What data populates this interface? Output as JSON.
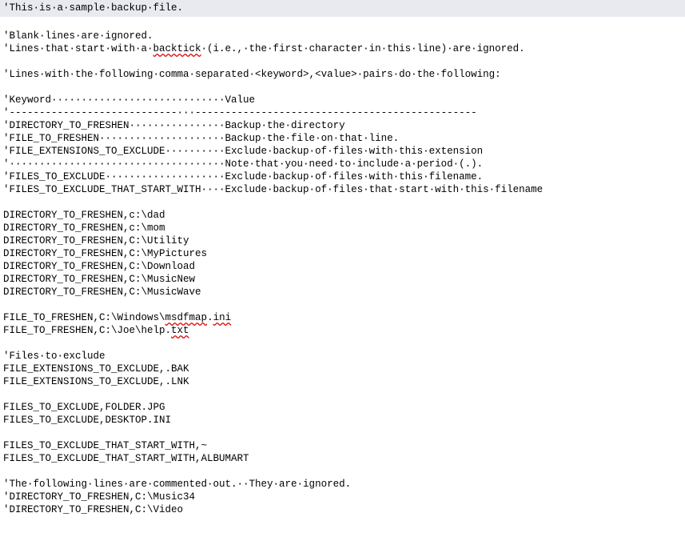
{
  "header": {
    "bg": "#e9e9f0",
    "text": "'This·is·a·sample·backup·file."
  },
  "lines": [
    {
      "t": "blank"
    },
    {
      "t": "line",
      "txt": "'Blank·lines·are·ignored."
    },
    {
      "t": "line",
      "parts": [
        {
          "s": "plain",
          "txt": "'Lines·that·start·with·a·"
        },
        {
          "s": "squiggle",
          "txt": "backtick"
        },
        {
          "s": "plain",
          "txt": "·(i.e.,·the·first·character·in·this·line)·are·ignored."
        }
      ]
    },
    {
      "t": "blank"
    },
    {
      "t": "line",
      "txt": "'Lines·with·the·following·comma·separated·<keyword>,<value>·pairs·do·the·following:"
    },
    {
      "t": "blank"
    },
    {
      "t": "line",
      "txt": "'Keyword·····························Value"
    },
    {
      "t": "line",
      "txt": "'----------------------------···-----------------------------------------------"
    },
    {
      "t": "line",
      "txt": "'DIRECTORY_TO_FRESHEN················Backup·the·directory"
    },
    {
      "t": "line",
      "txt": "'FILE_TO_FRESHEN·····················Backup·the·file·on·that·line."
    },
    {
      "t": "line",
      "txt": "'FILE_EXTENSIONS_TO_EXCLUDE··········Exclude·backup·of·files·with·this·extension"
    },
    {
      "t": "line",
      "txt": "'····································Note·that·you·need·to·include·a·period·(.)."
    },
    {
      "t": "line",
      "txt": "'FILES_TO_EXCLUDE····················Exclude·backup·of·files·with·this·filename."
    },
    {
      "t": "line",
      "txt": "'FILES_TO_EXCLUDE_THAT_START_WITH····Exclude·backup·of·files·that·start·with·this·filename"
    },
    {
      "t": "blank"
    },
    {
      "t": "line",
      "txt": "DIRECTORY_TO_FRESHEN,c:\\dad"
    },
    {
      "t": "line",
      "txt": "DIRECTORY_TO_FRESHEN,c:\\mom"
    },
    {
      "t": "line",
      "txt": "DIRECTORY_TO_FRESHEN,C:\\Utility"
    },
    {
      "t": "line",
      "txt": "DIRECTORY_TO_FRESHEN,C:\\MyPictures"
    },
    {
      "t": "line",
      "txt": "DIRECTORY_TO_FRESHEN,C:\\Download"
    },
    {
      "t": "line",
      "txt": "DIRECTORY_TO_FRESHEN,C:\\MusicNew"
    },
    {
      "t": "line",
      "txt": "DIRECTORY_TO_FRESHEN,C:\\MusicWave"
    },
    {
      "t": "blank"
    },
    {
      "t": "line",
      "parts": [
        {
          "s": "plain",
          "txt": "FILE_TO_FRESHEN,C:\\Windows\\"
        },
        {
          "s": "squiggle",
          "txt": "msdfmap"
        },
        {
          "s": "plain",
          "txt": "."
        },
        {
          "s": "squiggle",
          "txt": "ini"
        }
      ]
    },
    {
      "t": "line",
      "parts": [
        {
          "s": "plain",
          "txt": "FILE_TO_FRESHEN,C:\\Joe\\help."
        },
        {
          "s": "squiggle",
          "txt": "txt"
        }
      ]
    },
    {
      "t": "blank"
    },
    {
      "t": "line",
      "txt": "'Files·to·exclude"
    },
    {
      "t": "line",
      "txt": "FILE_EXTENSIONS_TO_EXCLUDE,.BAK"
    },
    {
      "t": "line",
      "txt": "FILE_EXTENSIONS_TO_EXCLUDE,.LNK"
    },
    {
      "t": "blank"
    },
    {
      "t": "line",
      "txt": "FILES_TO_EXCLUDE,FOLDER.JPG"
    },
    {
      "t": "line",
      "txt": "FILES_TO_EXCLUDE,DESKTOP.INI"
    },
    {
      "t": "blank"
    },
    {
      "t": "line",
      "txt": "FILES_TO_EXCLUDE_THAT_START_WITH,~"
    },
    {
      "t": "line",
      "txt": "FILES_TO_EXCLUDE_THAT_START_WITH,ALBUMART"
    },
    {
      "t": "blank"
    },
    {
      "t": "line",
      "txt": "'The·following·lines·are·commented·out.··They·are·ignored."
    },
    {
      "t": "line",
      "txt": "'DIRECTORY_TO_FRESHEN,C:\\Music34"
    },
    {
      "t": "line",
      "txt": "'DIRECTORY_TO_FRESHEN,C:\\Video"
    },
    {
      "t": "blank"
    }
  ]
}
